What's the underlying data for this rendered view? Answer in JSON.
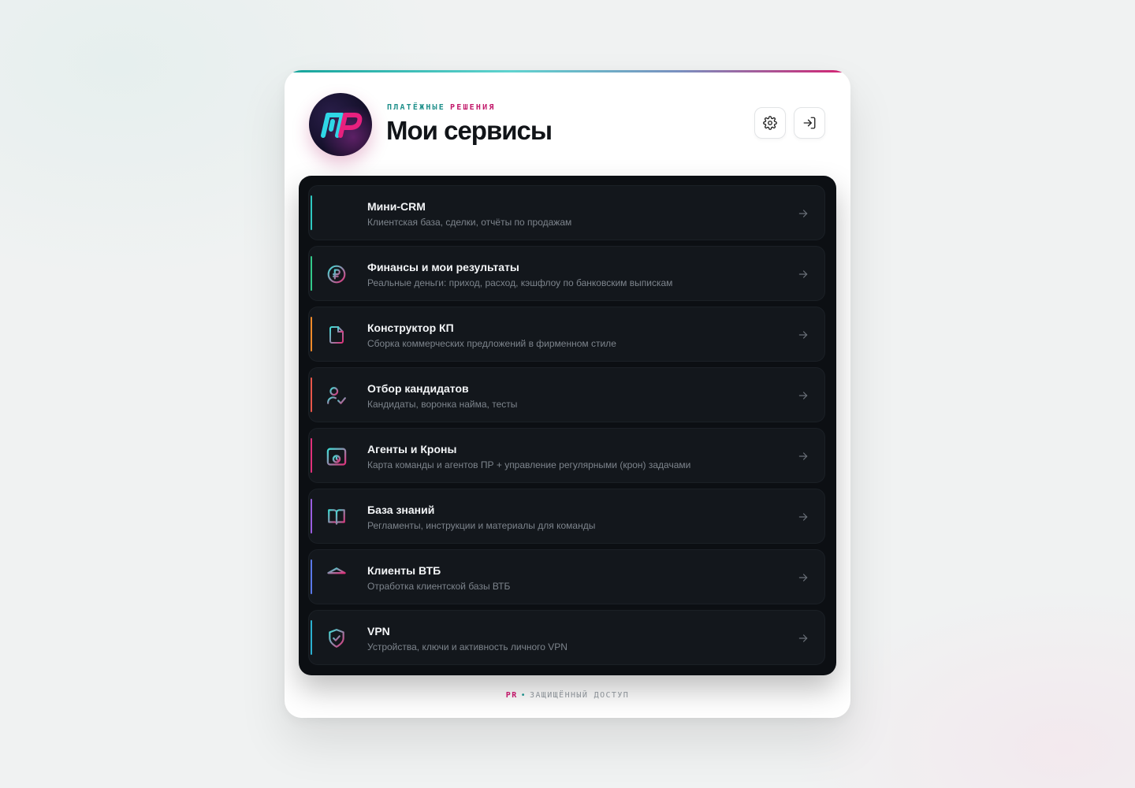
{
  "header": {
    "eyebrow_left": "ПЛАТЁЖНЫЕ",
    "eyebrow_right": "РЕШЕНИЯ",
    "title": "Мои сервисы",
    "logo_icon": "pr-logo-icon",
    "settings_icon": "gear-icon",
    "logout_icon": "login-arrow-icon"
  },
  "services": [
    {
      "name": "Мини-CRM",
      "desc": "Клиентская база, сделки, отчёты по продажам",
      "icon": "bar-chart-icon",
      "accent": "#2ec8c0"
    },
    {
      "name": "Финансы и мои результаты",
      "desc": "Реальные деньги: приход, расход, кэшфлоу по банковским выпискам",
      "icon": "ruble-coin-icon",
      "accent": "#33c98a"
    },
    {
      "name": "Конструктор КП",
      "desc": "Сборка коммерческих предложений в фирменном стиле",
      "icon": "document-icon",
      "accent": "#f08a2a"
    },
    {
      "name": "Отбор кандидатов",
      "desc": "Кандидаты, воронка найма, тесты",
      "icon": "user-check-icon",
      "accent": "#e8564a"
    },
    {
      "name": "Агенты и Кроны",
      "desc": "Карта команды и агентов ПР + управление регулярными (крон) задачами",
      "icon": "calendar-clock-icon",
      "accent": "#e0307a"
    },
    {
      "name": "База знаний",
      "desc": "Регламенты, инструкции и материалы для команды",
      "icon": "book-icon",
      "accent": "#9a5ee0"
    },
    {
      "name": "Клиенты ВТБ",
      "desc": "Отработка клиентской базы ВТБ",
      "icon": "bank-icon",
      "accent": "#5a78e8"
    },
    {
      "name": "VPN",
      "desc": "Устройства, ключи и активность личного VPN",
      "icon": "shield-check-icon",
      "accent": "#2ab0d0"
    }
  ],
  "footer": {
    "brand": "PR",
    "separator": "•",
    "text": "ЗАЩИЩЁННЫЙ ДОСТУП"
  },
  "colors": {
    "teal": "#1e8f8a",
    "magenta": "#c2186a",
    "panel_bg": "#0c0f13",
    "item_bg": "#13171c"
  }
}
